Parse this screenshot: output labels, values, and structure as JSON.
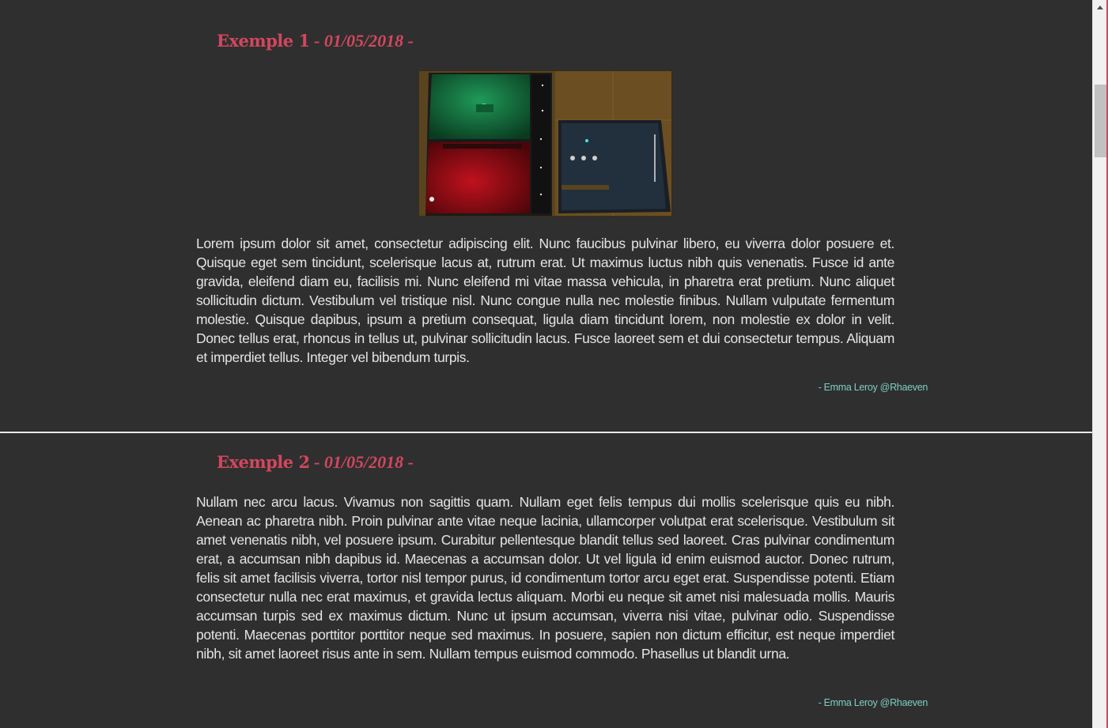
{
  "posts": [
    {
      "title": "Exemple 1",
      "separator": " - ",
      "date": "01/05/2018 -",
      "text": "Lorem ipsum dolor sit amet, consectetur adipiscing elit. Nunc faucibus pulvinar libero, eu viverra dolor posuere et. Quisque eget sem tincidunt, scelerisque lacus at, rutrum erat. Ut maximus luctus nibh quis venenatis. Fusce id ante gravida, eleifend diam eu, facilisis mi. Nunc eleifend mi vitae massa vehicula, in pharetra erat pretium. Nunc aliquet sollicitudin dictum. Vestibulum vel tristique nisl. Nunc congue nulla nec molestie finibus. Nullam vulputate fermentum molestie. Quisque dapibus, ipsum a pretium consequat, ligula diam tincidunt lorem, non molestie ex dolor in velit. Donec tellus erat, rhoncus in tellus ut, pulvinar sollicitudin lacus. Fusce laoreet sem et dui consectetur tempus. Aliquam et imperdiet tellus. Integer vel bibendum turpis.",
      "author": "- Emma Leroy @Rhaeven"
    },
    {
      "title": "Exemple 2",
      "separator": " - ",
      "date": "01/05/2018 -",
      "text": "Nullam nec arcu lacus. Vivamus non sagittis quam. Nullam eget felis tempus dui mollis scelerisque quis eu nibh. Aenean ac pharetra nibh. Proin pulvinar ante vitae neque lacinia, ullamcorper volutpat erat scelerisque. Vestibulum sit amet venenatis nibh, vel posuere ipsum. Curabitur pellentesque blandit tellus sed laoreet. Cras pulvinar condimentum erat, a accumsan nibh dapibus id. Maecenas a accumsan dolor. Ut vel ligula id enim euismod auctor. Donec rutrum, felis sit amet facilisis viverra, tortor nisl tempor purus, id condimentum tortor arcu eget erat. Suspendisse potenti. Etiam consectetur nulla nec erat maximus, et gravida lectus aliquam. Morbi eu neque sit amet nisi malesuada mollis. Mauris accumsan turpis sed ex maximus dictum. Nunc ut ipsum accumsan, viverra nisi vitae, pulvinar odio. Suspendisse potenti. Maecenas porttitor porttitor neque sed maximus. In posuere, sapien non dictum efficitur, est neque imperdiet nibh, sit amet laoreet risus ante in sem. Nullam tempus euismod commodo. Phasellus ut blandit urna.",
      "author": "- Emma Leroy @Rhaeven"
    }
  ],
  "colors": {
    "background": "#2f2f2f",
    "title": "#d2475f",
    "text": "#e4e4e4",
    "author": "#7ecdc2",
    "divider": "#e8e8e8"
  },
  "icons": {
    "scroll_up": "arrow-up-icon"
  }
}
